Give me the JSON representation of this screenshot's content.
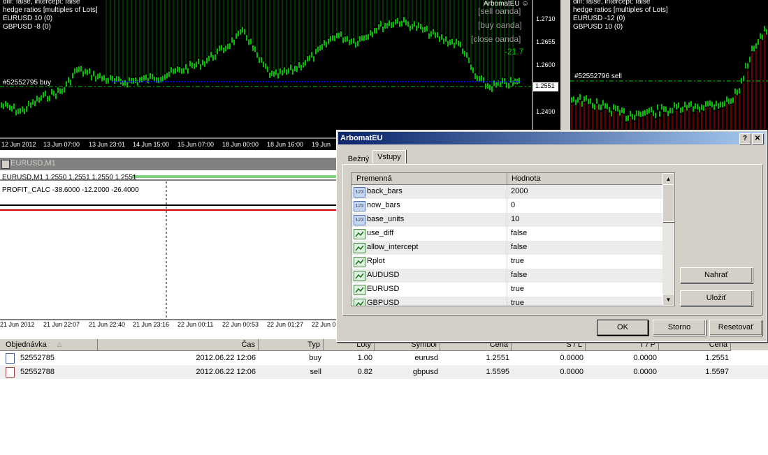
{
  "chart1": {
    "info": [
      "diff: false, intercept: false",
      "hedge ratios [multiples of Lots]",
      "EURUSD 10 (0)",
      "GBPUSD -8 (0)"
    ],
    "expert": "ArbomatEU ☺",
    "sell_btn": "[sell oanda]",
    "buy_btn": "[buy oanda]",
    "close_btn": "[close oanda]",
    "profit": "-21.7",
    "order_label": "#52552795 buy",
    "prices": [
      "1.2710",
      "1.2655",
      "1.2600",
      "1.2551",
      "1.2490"
    ],
    "time_labels": [
      "12 Jun 2012",
      "13 Jun 07:00",
      "13 Jun 23:01",
      "14 Jun 15:00",
      "15 Jun 07:00",
      "18 Jun 00:00",
      "18 Jun 16:00",
      "19 Jun"
    ]
  },
  "chart2": {
    "info": [
      "diff: false, intercept: false",
      "hedge ratios [multiples of Lots]",
      "EURUSD -12 (0)",
      "GBPUSD 10 (0)"
    ],
    "order_label": "#52552796 sell"
  },
  "window2": {
    "title": "EURUSD,M1",
    "indicator": "EURUSD,M1  1.2550 1.2551 1.2550 1.2551",
    "profit_calc": "PROFIT_CALC -38.6000 -12.2000 -26.4000",
    "time_labels": [
      "21 Jun 2012",
      "21 Jun 22:07",
      "21 Jun 22:40",
      "21 Jun 23:16",
      "22 Jun 00:11",
      "22 Jun 00:53",
      "22 Jun 01:27",
      "22 Jun 0"
    ]
  },
  "dialog": {
    "title": "ArbomatEU",
    "help": "?",
    "close": "✕",
    "tabs": [
      "Bežný",
      "Vstupy"
    ],
    "columns": [
      "Premenná",
      "Hodnota"
    ],
    "params": [
      {
        "name": "back_bars",
        "value": "2000",
        "icon": "integer-icon"
      },
      {
        "name": "now_bars",
        "value": "0",
        "icon": "integer-icon"
      },
      {
        "name": "base_units",
        "value": "10",
        "icon": "integer-icon"
      },
      {
        "name": "use_diff",
        "value": "false",
        "icon": "bool-icon"
      },
      {
        "name": "allow_intercept",
        "value": "false",
        "icon": "bool-icon"
      },
      {
        "name": "Rplot",
        "value": "true",
        "icon": "bool-icon"
      },
      {
        "name": "AUDUSD",
        "value": "false",
        "icon": "bool-icon"
      },
      {
        "name": "EURUSD",
        "value": "true",
        "icon": "bool-icon"
      },
      {
        "name": "GBPUSD",
        "value": "true",
        "icon": "bool-icon"
      }
    ],
    "load": "Nahrať",
    "save": "Uložiť",
    "ok": "OK",
    "cancel": "Storno",
    "reset": "Resetovať"
  },
  "orders": {
    "columns": [
      "Objednávka",
      "Čas",
      "Typ",
      "Loty",
      "Symbol",
      "Cena",
      "S / L",
      "T / P",
      "Cena"
    ],
    "rows": [
      {
        "id": "52552785",
        "time": "2012.06.22 12:06",
        "type": "buy",
        "lots": "1.00",
        "symbol": "eurusd",
        "price": "1.2551",
        "sl": "0.0000",
        "tp": "0.0000",
        "cur": "1.2551"
      },
      {
        "id": "52552788",
        "time": "2012.06.22 12:06",
        "type": "sell",
        "lots": "0.82",
        "symbol": "gbpusd",
        "price": "1.5595",
        "sl": "0.0000",
        "tp": "0.0000",
        "cur": "1.5597"
      }
    ]
  },
  "colors": {
    "bull": "#00ff00",
    "bear": "#ff0000",
    "order_line": "#00cc00",
    "blue_line": "#0000ff",
    "title_bar": "#0a246a"
  }
}
